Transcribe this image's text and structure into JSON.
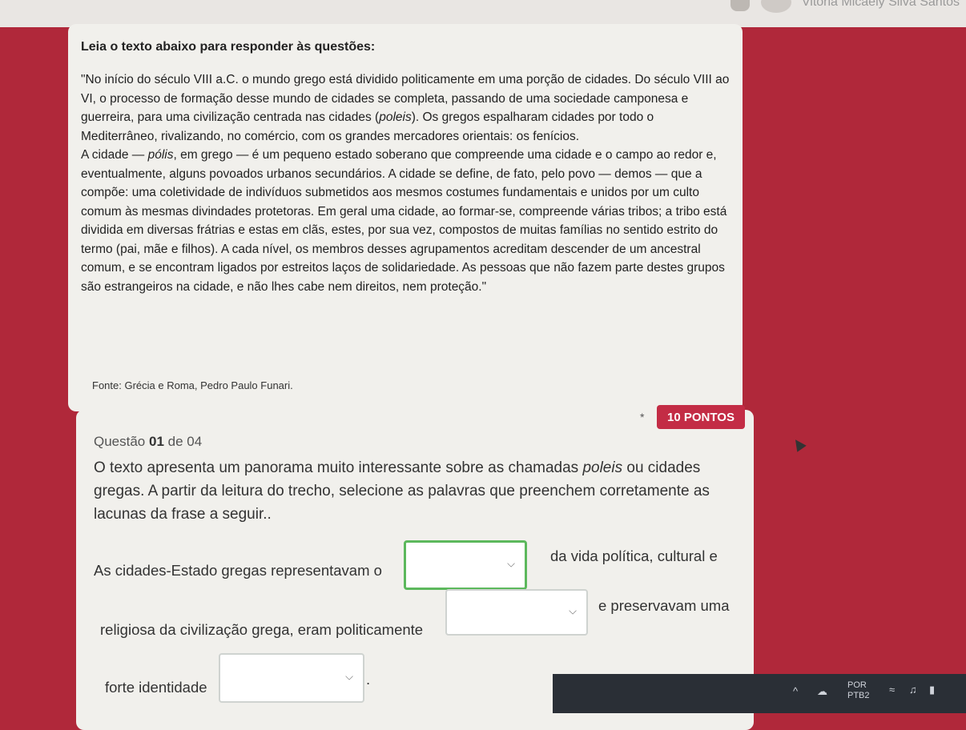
{
  "header": {
    "user_name": "Vitória Micaely Silva Santos"
  },
  "text_section": {
    "heading": "Leia o texto abaixo para responder às questões:",
    "quote_parts": {
      "p1": "\"No início do século VIII a.C. o mundo grego está dividido politicamente em uma porção de cidades. Do século VIII ao VI, o processo de formação desse mundo de cidades se completa, passando de uma sociedade camponesa e guerreira, para uma civilização centrada nas cidades (",
      "p1_em": "poleis",
      "p2": "). Os gregos espalharam cidades por todo o Mediterrâneo, rivalizando, no comércio, com os grandes mercadores orientais: os fenícios.",
      "p3": "A cidade — ",
      "p3_em": "pólis",
      "p4": ", em grego — é um pequeno estado soberano que compreende uma cidade e o campo ao redor e, eventualmente, alguns povoados urbanos secundários. A cidade se define, de fato, pelo povo — demos — que a compõe: uma coletividade de indivíduos submetidos aos mesmos costumes fundamentais e unidos por um culto comum às mesmas divindades protetoras. Em geral uma cidade, ao formar-se, compreende várias tribos; a tribo está dividida em diversas frátrias e estas em clãs, estes, por sua vez, compostos de muitas famílias no sentido estrito do termo (pai, mãe e filhos). A cada nível, os membros desses agrupamentos acreditam descender de um ancestral comum, e se encontram ligados por estreitos laços de solidariedade. As pessoas que não fazem parte destes grupos são estrangeiros na cidade, e não lhes cabe nem direitos, nem proteção.\""
    },
    "source": "Fonte: Grécia e Roma, Pedro Paulo Funari."
  },
  "question": {
    "points": "10 PONTOS",
    "required_mark": "*",
    "label_prefix": "Questão",
    "number": "01",
    "label_suffix": "de 04",
    "prompt_a": "O texto apresenta um panorama muito interessante sobre as chamadas ",
    "prompt_em": "poleis",
    "prompt_b": " ou cidades gregas. A partir da leitura do trecho, selecione as palavras que preenchem corretamente as lacunas da frase a seguir..",
    "sentence_1": "As cidades-Estado gregas representavam o",
    "sentence_2": "da vida política, cultural e",
    "sentence_3": "religiosa da civilização grega, eram politicamente",
    "sentence_4": "e preservavam uma",
    "sentence_5": "forte identidade",
    "sentence_6": ".",
    "dropdown_1_value": "",
    "dropdown_2_value": "",
    "dropdown_3_value": ""
  },
  "taskbar": {
    "lang_line1": "POR",
    "lang_line2": "PTB2"
  },
  "colors": {
    "background": "#b0283a",
    "points_badge": "#c32c45",
    "active_border": "#5cb85c"
  }
}
